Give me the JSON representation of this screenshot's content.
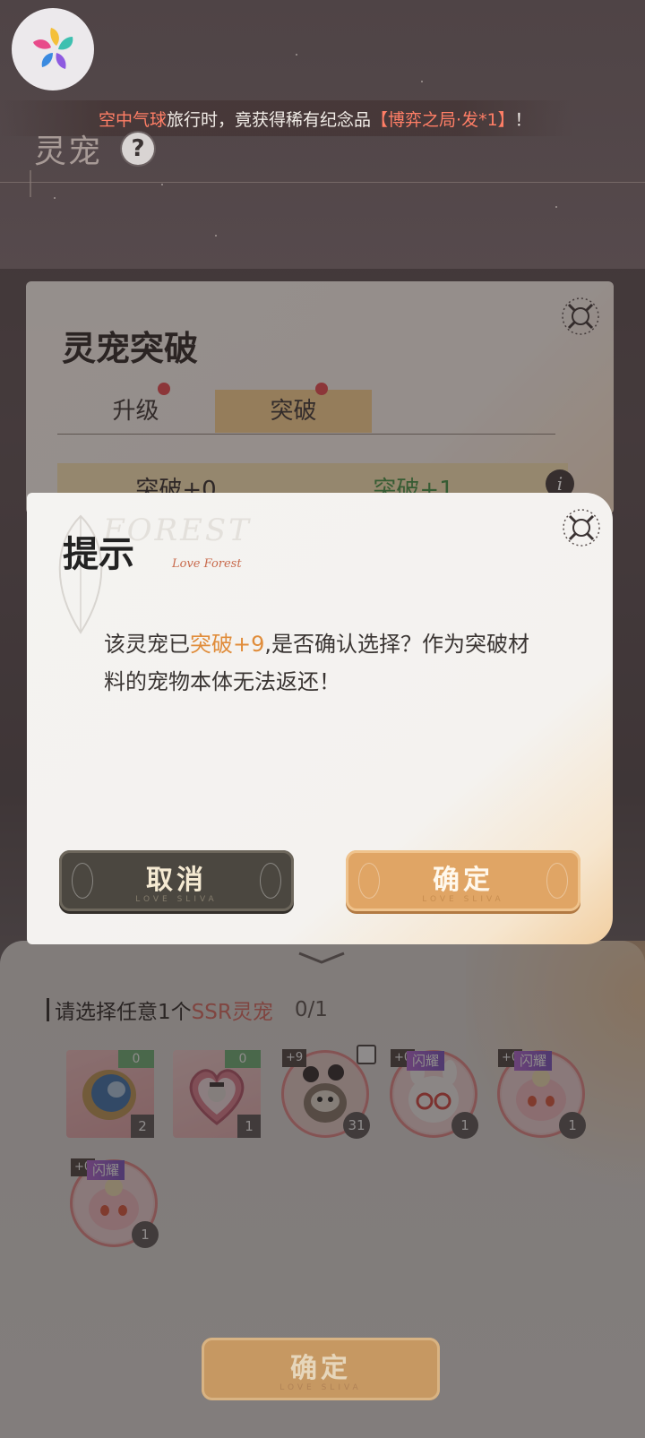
{
  "ticker": {
    "prefix": "空中气球",
    "middle": "旅行时，竟获得稀有纪念品",
    "item": "【博弈之局·发*1】",
    "suffix": "！"
  },
  "page": {
    "title": "灵宠",
    "help_label": "?"
  },
  "background_panel": {
    "title": "灵宠突破",
    "tabs": [
      {
        "label": "升级"
      },
      {
        "label": "突破"
      }
    ],
    "strip_left": "突破+0",
    "strip_right": "突破+1",
    "info_label": "i"
  },
  "dialog": {
    "title": "提示",
    "watermark": "FOREST",
    "script": "Love Forest",
    "message_part1": "该灵宠已",
    "message_highlight": "突破+9",
    "message_part2": ",是否确认选择？作为突破材料的宠物本体无法返还！",
    "cancel_label": "取消",
    "confirm_label": "确定",
    "button_sub": "LOVE SLIVA"
  },
  "selection": {
    "prefix": "请选择任意1个",
    "highlight": "SSR灵宠",
    "count": "0/1",
    "items": [
      {
        "badge": "0",
        "count": "2",
        "kind": "crystal-ball"
      },
      {
        "badge": "0",
        "count": "1",
        "kind": "heart-frame"
      },
      {
        "level": "+9",
        "count": "31",
        "kind": "raccoon"
      },
      {
        "level": "+0",
        "shine": "闪耀",
        "count": "1",
        "kind": "bunny-glasses"
      },
      {
        "level": "+0",
        "shine": "闪耀",
        "count": "1",
        "kind": "pink-sprite"
      },
      {
        "level": "+0",
        "shine": "闪耀",
        "count": "1",
        "kind": "pink-sprite"
      }
    ]
  },
  "main_button": {
    "label": "确定",
    "sub": "LOVE SLIVA"
  },
  "colors": {
    "accent": "#e0a565",
    "highlight": "#e08c3a",
    "ssr": "#e26d63",
    "shine": "#b567d8"
  }
}
